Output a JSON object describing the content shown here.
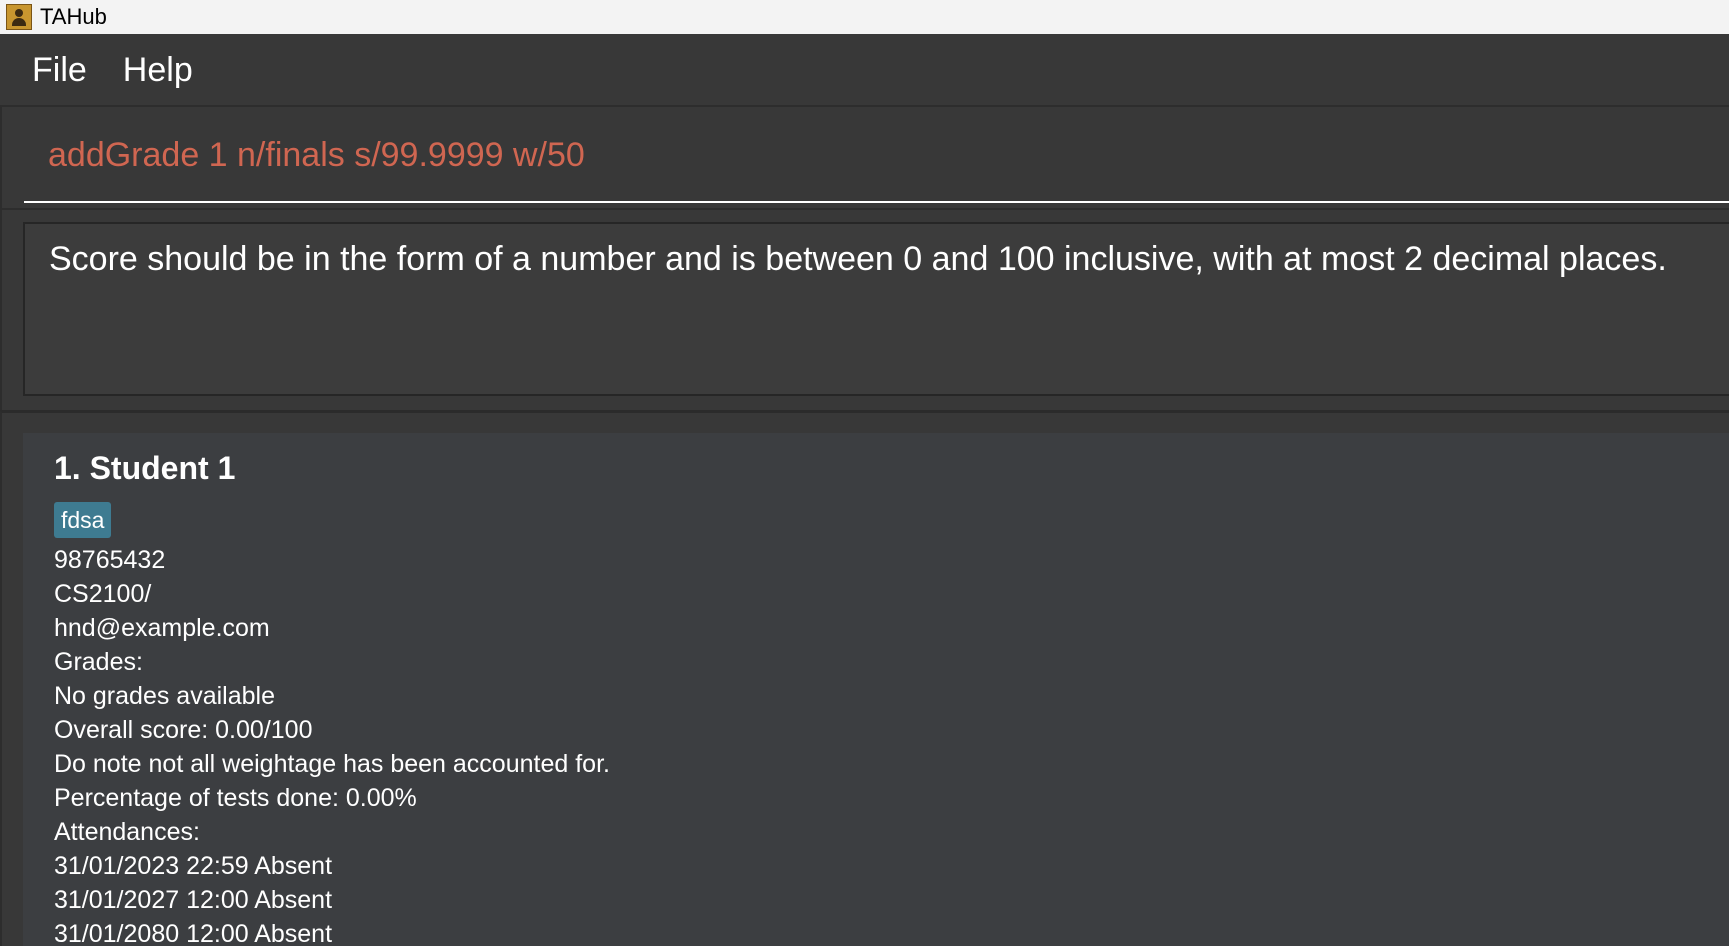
{
  "window": {
    "title": "TAHub",
    "icon": "address-book-icon"
  },
  "menu": {
    "items": [
      {
        "label": "File"
      },
      {
        "label": "Help"
      }
    ]
  },
  "command_box": {
    "value": "addGrade 1 n/finals s/99.9999 w/50",
    "text_color": "#d06651"
  },
  "result_display": {
    "text": "Score should be in the form of a number and is between 0 and 100 inclusive, with at most 2 decimal places."
  },
  "person_list": [
    {
      "name": "1. Student 1",
      "tags": [
        "fdsa"
      ],
      "phone": "98765432",
      "module": "CS2100/",
      "email": "hnd@example.com",
      "grades_label": "Grades:",
      "grades_text": "No grades available",
      "overall_score": "Overall score: 0.00/100",
      "weightage_note": "Do note not all weightage has been accounted for.",
      "tests_done": "Percentage of tests done: 0.00%",
      "attendances_label": "Attendances:",
      "attendances": [
        "31/01/2023 22:59 Absent",
        "31/01/2027 12:00 Absent",
        "31/01/2080 12:00 Absent"
      ]
    }
  ],
  "colors": {
    "background": "#383838",
    "tag": "#3e7b91",
    "card": "#3c3e41"
  }
}
